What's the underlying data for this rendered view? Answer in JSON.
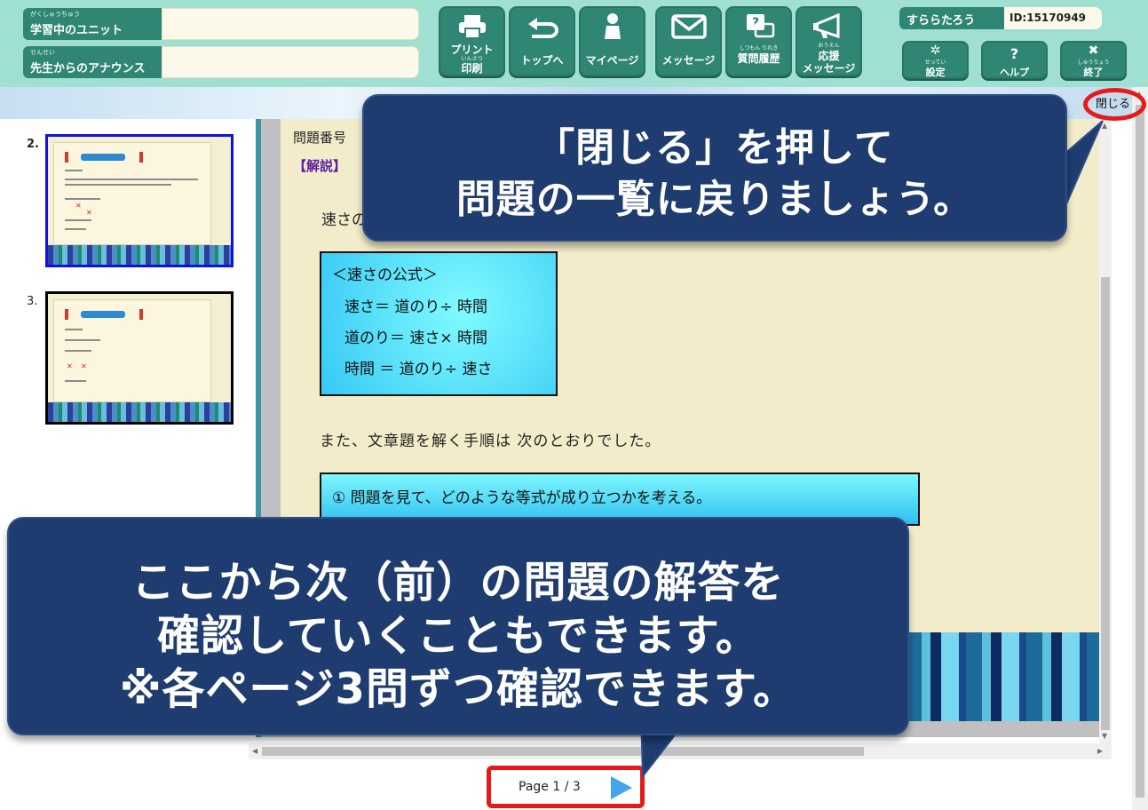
{
  "header": {
    "unit_ruby": "がくしゅうちゅう",
    "unit_label": "学習中のユニット",
    "announce_ruby": "せんせい",
    "announce_label": "先生からのアナウンス",
    "nav": [
      {
        "label1": "プリント",
        "ruby": "いんさつ",
        "label2": "印刷",
        "icon": "printer-icon"
      },
      {
        "label1": "トップへ",
        "icon": "return-arrow-icon"
      },
      {
        "label1": "マイページ",
        "icon": "person-icon"
      },
      {
        "label1": "メッセージ",
        "icon": "envelope-icon"
      },
      {
        "ruby": "しつもん りれき",
        "label1": "質問履歴",
        "icon": "question-chat-icon"
      },
      {
        "ruby": "おうえん",
        "label1": "応援",
        "label2": "メッセージ",
        "icon": "megaphone-icon"
      }
    ],
    "user_name": "すららたろう",
    "user_id": "ID:15170949",
    "settings": {
      "icon": "✲",
      "ruby": "せってい",
      "label": "設定"
    },
    "help": {
      "icon": "?",
      "label": "ヘルプ"
    },
    "exit": {
      "icon": "✖",
      "ruby": "しゅうりょう",
      "label": "終了"
    }
  },
  "close_label": "閉じる",
  "thumbnails": [
    {
      "number": "2.",
      "selected": true
    },
    {
      "number": "3.",
      "selected": false
    }
  ],
  "content": {
    "question_no": "問題番号",
    "kaisetsu": "【解説】",
    "intro": "速さの",
    "formula": {
      "title": "＜速さの公式＞",
      "line1": "速さ＝ 道のり÷ 時間",
      "line2": "道のり＝ 速さ× 時間",
      "line3": "時間 ＝ 道のり÷ 速さ"
    },
    "steps_text": "また、文章題を解く手順は 次のとおりでした。",
    "step1": "①  問題を見て、どのような等式が成り立つかを考える。"
  },
  "pager": {
    "text": "Page 1 / 3"
  },
  "callouts": {
    "top_line1": "「閉じる」を押して",
    "top_line2": "問題の一覧に戻りましょう。",
    "bottom_line1": "ここから次（前）の問題の解答を",
    "bottom_line2": "確認していくこともできます。",
    "bottom_line3": "※各ページ3問ずつ確認できます。"
  },
  "colors": {
    "header_bg": "#9fe0d2",
    "button": "#2f8674",
    "callout": "#1e3c6f",
    "highlight": "#e61a1a"
  }
}
